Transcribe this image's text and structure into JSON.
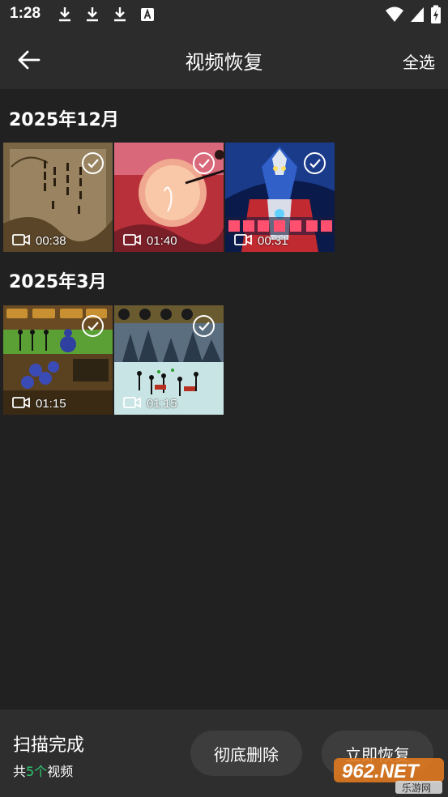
{
  "status_bar": {
    "time": "1:28"
  },
  "app_bar": {
    "title": "视频恢复",
    "select_all": "全选"
  },
  "groups": [
    {
      "title": "2025年12月",
      "videos": [
        {
          "duration": "00:38",
          "selected": true
        },
        {
          "duration": "01:40",
          "selected": true
        },
        {
          "duration": "00:31",
          "selected": true
        }
      ]
    },
    {
      "title": "2025年3月",
      "videos": [
        {
          "duration": "01:15",
          "selected": true
        },
        {
          "duration": "01:15",
          "selected": true
        }
      ]
    }
  ],
  "bottom": {
    "scan_status": "扫描完成",
    "count_prefix": "共",
    "count_value": "5个",
    "count_suffix": "视频",
    "delete_label": "彻底删除",
    "recover_label": "立即恢复"
  },
  "watermark": {
    "main": "962.NET",
    "sub": "乐游网"
  },
  "colors": {
    "accent": "#2ecc71",
    "background": "#212121",
    "bar": "#2c2c2c"
  }
}
